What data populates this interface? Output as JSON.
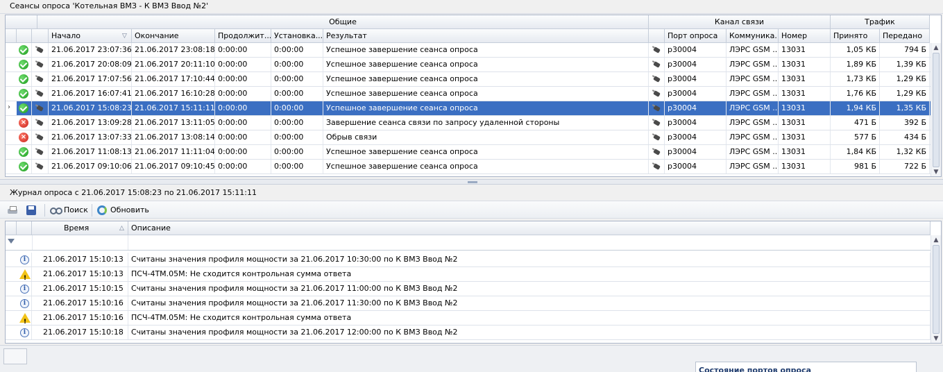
{
  "window_title": "Сеансы опроса 'Котельная ВМЗ - К ВМЗ Ввод №2'",
  "sessions": {
    "groups": {
      "general": "Общие",
      "channel": "Канал связи",
      "traffic": "Трафик"
    },
    "columns": {
      "start": "Начало",
      "end": "Окончание",
      "duration": "Продолжит...",
      "setup": "Установка...",
      "result": "Результат",
      "port": "Порт опроса",
      "comm": "Коммуника...",
      "number": "Номер",
      "received": "Принято",
      "sent": "Передано"
    },
    "rows": [
      {
        "status": "ok",
        "start": "21.06.2017 23:07:36",
        "end": "21.06.2017 23:08:18",
        "duration": "0:00:00",
        "setup": "0:00:00",
        "result": "Успешное завершение сеанса опроса",
        "port": "p30004",
        "comm": "ЛЭРС GSM ...",
        "number": "13031",
        "received": "1,05 КБ",
        "sent": "794 Б"
      },
      {
        "status": "ok",
        "start": "21.06.2017 20:08:09",
        "end": "21.06.2017 20:11:10",
        "duration": "0:00:00",
        "setup": "0:00:00",
        "result": "Успешное завершение сеанса опроса",
        "port": "p30004",
        "comm": "ЛЭРС GSM ...",
        "number": "13031",
        "received": "1,89 КБ",
        "sent": "1,39 КБ"
      },
      {
        "status": "ok",
        "start": "21.06.2017 17:07:56",
        "end": "21.06.2017 17:10:44",
        "duration": "0:00:00",
        "setup": "0:00:00",
        "result": "Успешное завершение сеанса опроса",
        "port": "p30004",
        "comm": "ЛЭРС GSM ...",
        "number": "13031",
        "received": "1,73 КБ",
        "sent": "1,29 КБ"
      },
      {
        "status": "ok",
        "start": "21.06.2017 16:07:41",
        "end": "21.06.2017 16:10:28",
        "duration": "0:00:00",
        "setup": "0:00:00",
        "result": "Успешное завершение сеанса опроса",
        "port": "p30004",
        "comm": "ЛЭРС GSM ...",
        "number": "13031",
        "received": "1,76 КБ",
        "sent": "1,29 КБ"
      },
      {
        "status": "ok",
        "selected": true,
        "start": "21.06.2017 15:08:23",
        "end": "21.06.2017 15:11:11",
        "duration": "0:00:00",
        "setup": "0:00:00",
        "result": "Успешное завершение сеанса опроса",
        "port": "p30004",
        "comm": "ЛЭРС GSM ...",
        "number": "13031",
        "received": "1,94 КБ",
        "sent": "1,35 КБ"
      },
      {
        "status": "error",
        "start": "21.06.2017 13:09:28",
        "end": "21.06.2017 13:11:05",
        "duration": "0:00:00",
        "setup": "0:00:00",
        "result": "Завершение сеанса связи по запросу удаленной стороны",
        "port": "p30004",
        "comm": "ЛЭРС GSM ...",
        "number": "13031",
        "received": "471 Б",
        "sent": "392 Б"
      },
      {
        "status": "error",
        "start": "21.06.2017 13:07:33",
        "end": "21.06.2017 13:08:14",
        "duration": "0:00:00",
        "setup": "0:00:00",
        "result": "Обрыв связи",
        "port": "p30004",
        "comm": "ЛЭРС GSM ...",
        "number": "13031",
        "received": "577 Б",
        "sent": "434 Б"
      },
      {
        "status": "ok",
        "start": "21.06.2017 11:08:13",
        "end": "21.06.2017 11:11:04",
        "duration": "0:00:00",
        "setup": "0:00:00",
        "result": "Успешное завершение сеанса опроса",
        "port": "p30004",
        "comm": "ЛЭРС GSM ...",
        "number": "13031",
        "received": "1,84 КБ",
        "sent": "1,32 КБ"
      },
      {
        "status": "ok",
        "start": "21.06.2017 09:10:06",
        "end": "21.06.2017 09:10:45",
        "duration": "0:00:00",
        "setup": "0:00:00",
        "result": "Успешное завершение сеанса опроса",
        "port": "p30004",
        "comm": "ЛЭРС GSM ...",
        "number": "13031",
        "received": "981 Б",
        "sent": "722 Б"
      }
    ]
  },
  "log": {
    "title": "Журнал опроса с 21.06.2017 15:08:23 по 21.06.2017 15:11:11",
    "toolbar": {
      "search": "Поиск",
      "refresh": "Обновить"
    },
    "columns": {
      "time": "Время",
      "description": "Описание"
    },
    "rows": [
      {
        "type": "info",
        "time": "21.06.2017 15:10:13",
        "description": "Считаны значения профиля мощности за 21.06.2017 10:30:00 по К ВМЗ Ввод №2"
      },
      {
        "type": "warning",
        "time": "21.06.2017 15:10:13",
        "description": "ПСЧ-4ТМ.05М: Не сходится контрольная сумма ответа"
      },
      {
        "type": "info",
        "time": "21.06.2017 15:10:15",
        "description": "Считаны значения профиля мощности за 21.06.2017 11:00:00 по К ВМЗ Ввод №2"
      },
      {
        "type": "info",
        "time": "21.06.2017 15:10:16",
        "description": "Считаны значения профиля мощности за 21.06.2017 11:30:00 по К ВМЗ Ввод №2"
      },
      {
        "type": "warning",
        "time": "21.06.2017 15:10:16",
        "description": "ПСЧ-4ТМ.05М: Не сходится контрольная сумма ответа"
      },
      {
        "type": "info",
        "time": "21.06.2017 15:10:18",
        "description": "Считаны значения профиля мощности за 21.06.2017 12:00:00 по К ВМЗ Ввод №2"
      }
    ]
  },
  "ports_panel": {
    "title": "Состояние портов опроса"
  },
  "colors": {
    "selection": "#3b6fc2",
    "header": "#e6eaf0",
    "border": "#a9b4c7"
  }
}
